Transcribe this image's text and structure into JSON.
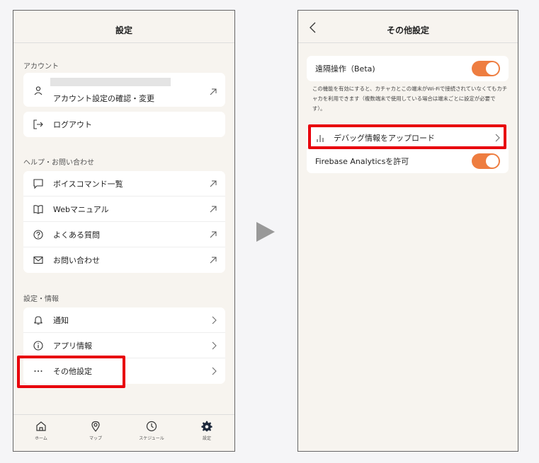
{
  "left": {
    "header_title": "設定",
    "account_section": "アカウント",
    "account_items": [
      {
        "label": "アカウント設定の確認・変更"
      },
      {
        "label": "ログアウト"
      }
    ],
    "help_section": "ヘルプ・お問い合わせ",
    "help_items": [
      {
        "label": "ボイスコマンド一覧"
      },
      {
        "label": "Webマニュアル"
      },
      {
        "label": "よくある質問"
      },
      {
        "label": "お問い合わせ"
      }
    ],
    "settings_section": "設定・情報",
    "settings_items": [
      {
        "label": "通知"
      },
      {
        "label": "アプリ情報"
      },
      {
        "label": "その他設定"
      }
    ],
    "tabs": [
      {
        "label": "ホーム",
        "icon": "home-icon"
      },
      {
        "label": "マップ",
        "icon": "map-pin-icon"
      },
      {
        "label": "スケジュール",
        "icon": "clock-icon"
      },
      {
        "label": "設定",
        "icon": "gear-icon"
      }
    ]
  },
  "right": {
    "header_title": "その他設定",
    "remote_label": "遠隔操作（Beta)",
    "remote_desc": "この機能を有効にすると、カチャカとこの端末がWi-Fiで接続されていなくてもカチャカを利用できます（複数端末で使用している場合は端末ごとに設定が必要です）。",
    "debug_label": "デバッグ情報をアップロード",
    "analytics_label": "Firebase Analyticsを許可"
  },
  "colors": {
    "accent": "#ee7d40",
    "highlight": "#e8000b",
    "background": "#f7f4ef"
  }
}
